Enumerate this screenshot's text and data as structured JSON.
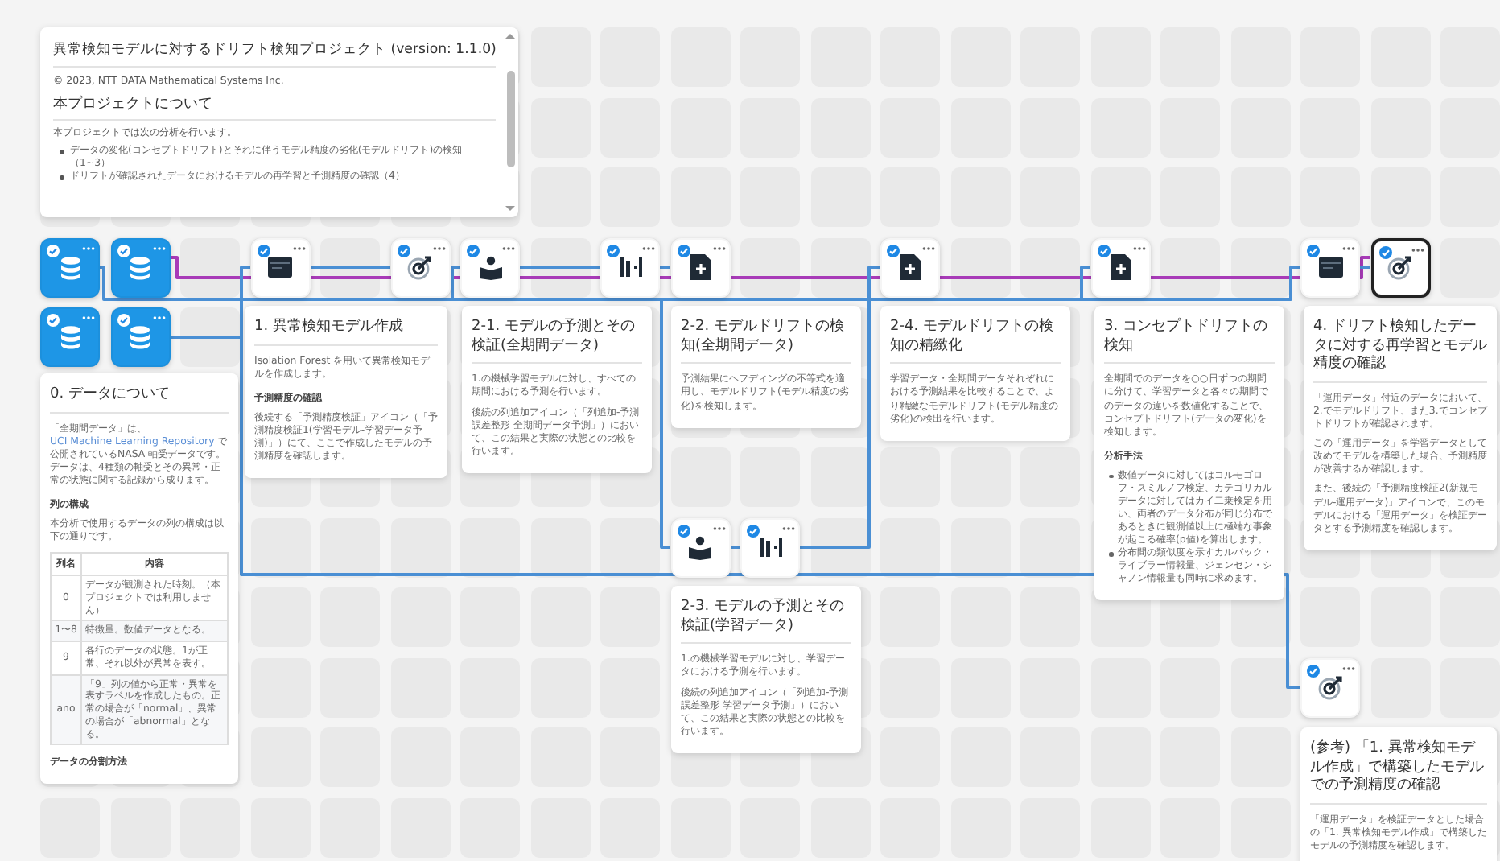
{
  "info_panel": {
    "title": "異常検知モデルに対するドリフト検知プロジェクト (version: 1.1.0)",
    "copyright": "© 2023, NTT DATA Mathematical Systems Inc.",
    "heading": "本プロジェクトについて",
    "intro": "本プロジェクトでは次の分析を行います。",
    "bullets": [
      "データの変化(コンセプトドリフト)とそれに伴うモデル精度の劣化(モデルドリフト)の検知（1~3）",
      "ドリフトが確認されたデータにおけるモデルの再学習と予測精度の確認（4）"
    ]
  },
  "nodes": [
    {
      "kind": "data",
      "checked": true,
      "selected": false
    },
    {
      "kind": "data",
      "checked": true,
      "selected": false
    },
    {
      "kind": "data",
      "checked": true,
      "selected": false
    },
    {
      "kind": "data",
      "checked": true,
      "selected": false
    },
    {
      "kind": "process",
      "checked": true,
      "selected": false
    },
    {
      "kind": "process",
      "checked": true,
      "selected": false
    },
    {
      "kind": "process",
      "checked": true,
      "selected": false
    },
    {
      "kind": "process",
      "checked": true,
      "selected": false
    },
    {
      "kind": "process",
      "checked": true,
      "selected": false
    },
    {
      "kind": "process",
      "checked": true,
      "selected": false
    },
    {
      "kind": "process",
      "checked": true,
      "selected": false
    },
    {
      "kind": "process",
      "checked": true,
      "selected": false
    },
    {
      "kind": "process",
      "checked": true,
      "selected": true
    },
    {
      "kind": "process",
      "checked": true,
      "selected": false
    },
    {
      "kind": "process",
      "checked": true,
      "selected": false
    },
    {
      "kind": "process",
      "checked": true,
      "selected": false
    }
  ],
  "cards": [
    {
      "title": "0. データについて",
      "blocks": [
        {
          "kind": "linked_text",
          "before": "「全期間データ」は、",
          "link": "UCI Machine Learning Repository",
          "after": " で公開されているNASA 軸受データです。データは、4種類の軸受とその異常・正常の状態に関する記録から成ります。"
        },
        {
          "kind": "heading",
          "text": "列の構成"
        },
        {
          "kind": "text",
          "text": "本分析で使用するデータの列の構成は以下の通りです。"
        },
        {
          "kind": "table",
          "columns": [
            "列名",
            "内容"
          ],
          "rows": [
            [
              "0",
              "データが観測された時刻。（本プロジェクトでは利用しません）"
            ],
            [
              "1〜8",
              "特徴量。数値データとなる。"
            ],
            [
              "9",
              "各行のデータの状態。1が正常、それ以外が異常を表す。"
            ],
            [
              "ano",
              "「9」列の値から正常・異常を表すラベルを作成したもの。正常の場合が「normal」、異常の場合が「abnormal」となる。"
            ]
          ]
        },
        {
          "kind": "heading",
          "text": "データの分割方法"
        }
      ]
    },
    {
      "title": "1. 異常検知モデル作成",
      "blocks": [
        {
          "kind": "text",
          "text": "Isolation Forest を用いて異常検知モデルを作成します。"
        },
        {
          "kind": "heading",
          "text": "予測精度の確認"
        },
        {
          "kind": "text",
          "text": "後続する「予測精度検証」アイコン（「予測精度検証1(学習モデル-学習データ予測)」）にて、ここで作成したモデルの予測精度を確認します。"
        }
      ]
    },
    {
      "title": "2-1. モデルの予測とその検証(全期間データ)",
      "blocks": [
        {
          "kind": "text",
          "text": "1.の機械学習モデルに対し、すべての期間における予測を行います。"
        },
        {
          "kind": "text",
          "text": "後続の列追加アイコン（「列追加-予測誤差整形 全期間データ予測」）において、この結果と実際の状態との比較を行います。"
        }
      ]
    },
    {
      "title": "2-2. モデルドリフトの検知(全期間データ)",
      "blocks": [
        {
          "kind": "text",
          "text": "予測結果にヘフディングの不等式を適用し、モデルドリフト(モデル精度の劣化)を検知します。"
        }
      ]
    },
    {
      "title": "2-4. モデルドリフトの検知の精緻化",
      "blocks": [
        {
          "kind": "text",
          "text": "学習データ・全期間データそれぞれにおける予測結果を比較することで、より精緻なモデルドリフト(モデル精度の劣化)の検出を行います。"
        }
      ]
    },
    {
      "title": "3. コンセプトドリフトの検知",
      "blocks": [
        {
          "kind": "text",
          "text": "全期間でのデータを○○日ずつの期間に分けて、学習データと各々の期間でのデータの違いを数値化することで、コンセプトドリフト(データの変化)を検知します。"
        },
        {
          "kind": "heading",
          "text": "分析手法"
        },
        {
          "kind": "bullets",
          "items": [
            "数値データに対してはコルモゴロフ・スミルノフ検定、カテゴリカルデータに対してはカイ二乗検定を用い、両者のデータ分布が同じ分布であるときに観測値以上に極端な事象が起こる確率(p値)を算出します。",
            "分布間の類似度を示すカルバック・ライブラー情報量、ジェンセン・シャノン情報量も同時に求めます。"
          ]
        }
      ]
    },
    {
      "title": "4. ドリフト検知したデータに対する再学習とモデル精度の確認",
      "blocks": [
        {
          "kind": "text",
          "text": "「運用データ」付近のデータにおいて、2.でモデルドリフト、また3.でコンセプトドリフトが確認されます。"
        },
        {
          "kind": "text",
          "text": "この「運用データ」を学習データとして改めてモデルを構築した場合、予測精度が改善するか確認します。"
        },
        {
          "kind": "text",
          "text": "また、後続の「予測精度検証2(新規モデル-運用データ)」アイコンで、このモデルにおける「運用データ」を検証データとする予測精度を確認します。"
        }
      ]
    },
    {
      "title": "2-3. モデルの予測とその検証(学習データ)",
      "blocks": [
        {
          "kind": "text",
          "text": "1.の機械学習モデルに対し、学習データにおける予測を行います。"
        },
        {
          "kind": "text",
          "text": "後続の列追加アイコン（「列追加-予測誤差整形 学習データ予測」）において、この結果と実際の状態との比較を行います。"
        }
      ]
    },
    {
      "title": "(参考) 「1. 異常検知モデル作成」で構築したモデルでの予測精度の確認",
      "blocks": [
        {
          "kind": "text",
          "text": "「運用データ」を検証データとした場合の「1. 異常検知モデル作成」で構築したモデルの予測精度を確認します。"
        }
      ]
    }
  ]
}
